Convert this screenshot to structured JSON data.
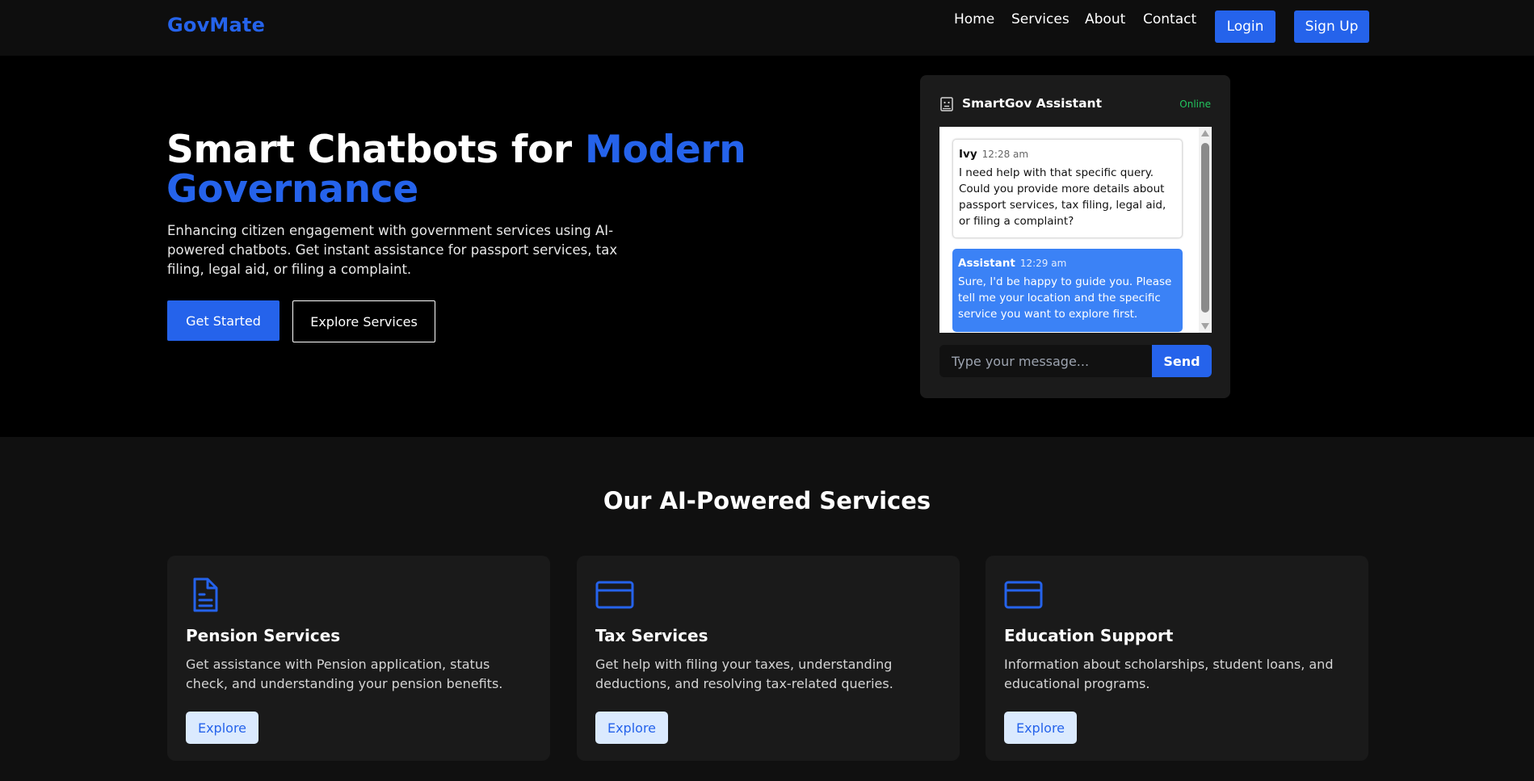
{
  "nav": {
    "brand": "GovMate",
    "links": [
      "Home",
      "Services",
      "About",
      "Contact"
    ],
    "login_label": "Login",
    "signup_label": "Sign Up"
  },
  "hero": {
    "title_plain": "Smart Chatbots for ",
    "title_accent": "Modern Governance",
    "subtitle": "Enhancing citizen engagement with government services using AI-powered chatbots. Get instant assistance for passport services, tax filing, legal aid, or filing a complaint.",
    "primary_button": "Get Started",
    "secondary_button": "Explore Services"
  },
  "chat": {
    "title": "SmartGov Assistant",
    "status": "Online",
    "messages": [
      {
        "sender": "Ivy",
        "time": "12:28 am",
        "text": "I need help with that specific query. Could you provide more details about passport services, tax filing, legal aid, or filing a complaint?"
      },
      {
        "sender": "Assistant",
        "time": "12:29 am",
        "text": "Sure, I'd be happy to guide you. Please tell me your location and the specific service you want to explore first."
      }
    ],
    "input_placeholder": "Type your message...",
    "send_label": "Send"
  },
  "services": {
    "title": "Our AI-Powered Services",
    "cards": [
      {
        "icon": "document-icon",
        "title": "Pension Services",
        "description": "Get assistance with Pension application, status check, and understanding your pension benefits.",
        "button": "Explore"
      },
      {
        "icon": "credit-card-icon",
        "title": "Tax Services",
        "description": "Get help with filing your taxes, understanding deductions, and resolving tax-related queries.",
        "button": "Explore"
      },
      {
        "icon": "credit-card-icon",
        "title": "Education Support",
        "description": "Information about scholarships, student loans, and educational programs.",
        "button": "Explore"
      }
    ]
  },
  "colors": {
    "accent": "#2563eb",
    "online": "#22c55e",
    "bot_bubble": "#3b82f6",
    "explore_bg": "#dbeafe"
  }
}
